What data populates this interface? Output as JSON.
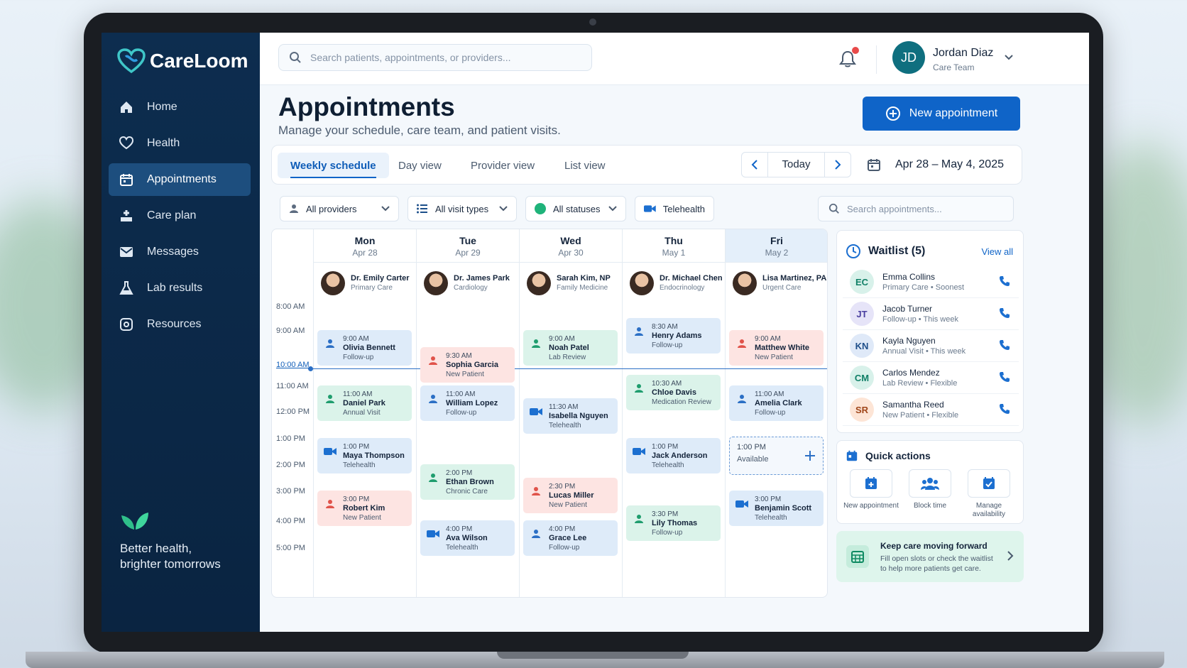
{
  "app": {
    "name": "CareLoom"
  },
  "sidebar": {
    "items": [
      {
        "label": "Home",
        "icon": "home-icon"
      },
      {
        "label": "Health",
        "icon": "heart-icon"
      },
      {
        "label": "Appointments",
        "icon": "calendar-icon"
      },
      {
        "label": "Care plan",
        "icon": "care-plan-icon"
      },
      {
        "label": "Messages",
        "icon": "mail-icon"
      },
      {
        "label": "Lab results",
        "icon": "flask-icon"
      },
      {
        "label": "Resources",
        "icon": "resources-icon"
      }
    ],
    "active": "Appointments",
    "tagline": "Better health, brighter tomorrows"
  },
  "topbar": {
    "search_placeholder": "Search patients, appointments, or providers...",
    "user": {
      "initials": "JD",
      "name": "Jordan Diaz",
      "role": "Care Team"
    }
  },
  "page": {
    "title": "Appointments",
    "subtitle": "Manage your schedule, care team, and patient visits.",
    "new_button": "New appointment"
  },
  "tabs": [
    "Weekly schedule",
    "Day view",
    "Provider view",
    "List view"
  ],
  "tabs_active": "Weekly schedule",
  "date_nav": {
    "today": "Today",
    "range": "Apr 28 – May 4, 2025"
  },
  "filters": {
    "providers": "All providers",
    "visit_types": "All visit types",
    "statuses": "All statuses",
    "telehealth": "Telehealth",
    "search_placeholder": "Search appointments..."
  },
  "calendar": {
    "days": [
      {
        "day": "Mon",
        "date": "Apr 28"
      },
      {
        "day": "Tue",
        "date": "Apr 29"
      },
      {
        "day": "Wed",
        "date": "Apr 30"
      },
      {
        "day": "Thu",
        "date": "May 1"
      },
      {
        "day": "Fri",
        "date": "May 2"
      }
    ],
    "providers": [
      {
        "name": "Dr. Emily Carter",
        "specialty": "Primary Care"
      },
      {
        "name": "Dr. James Park",
        "specialty": "Cardiology"
      },
      {
        "name": "Sarah Kim, NP",
        "specialty": "Family Medicine"
      },
      {
        "name": "Dr. Michael Chen",
        "specialty": "Endocrinology"
      },
      {
        "name": "Lisa Martinez, PA",
        "specialty": "Urgent Care"
      }
    ],
    "times": [
      "8:00 AM",
      "9:00 AM",
      "10:00 AM",
      "11:00 AM",
      "12:00 PM",
      "1:00 PM",
      "2:00 PM",
      "3:00 PM",
      "4:00 PM",
      "5:00 PM"
    ],
    "current_time": "10:00 AM",
    "appointments": [
      {
        "day": 0,
        "time": "9:00 AM",
        "patient": "Olivia Bennett",
        "type": "Follow-up",
        "color": "blue",
        "icon": "person-icon"
      },
      {
        "day": 0,
        "time": "11:00 AM",
        "patient": "Daniel Park",
        "type": "Annual Visit",
        "color": "green",
        "icon": "person-icon"
      },
      {
        "day": 0,
        "time": "1:00 PM",
        "patient": "Maya Thompson",
        "type": "Telehealth",
        "color": "blue",
        "icon": "video-icon"
      },
      {
        "day": 0,
        "time": "3:00 PM",
        "patient": "Robert Kim",
        "type": "New Patient",
        "color": "red",
        "icon": "person-icon"
      },
      {
        "day": 1,
        "time": "9:30 AM",
        "patient": "Sophia Garcia",
        "type": "New Patient",
        "color": "red",
        "icon": "person-icon"
      },
      {
        "day": 1,
        "time": "11:00 AM",
        "patient": "William Lopez",
        "type": "Follow-up",
        "color": "blue",
        "icon": "person-icon"
      },
      {
        "day": 1,
        "time": "2:00 PM",
        "patient": "Ethan Brown",
        "type": "Chronic Care",
        "color": "green",
        "icon": "person-icon"
      },
      {
        "day": 1,
        "time": "4:00 PM",
        "patient": "Ava Wilson",
        "type": "Telehealth",
        "color": "blue",
        "icon": "video-icon"
      },
      {
        "day": 2,
        "time": "9:00 AM",
        "patient": "Noah Patel",
        "type": "Lab Review",
        "color": "green",
        "icon": "person-icon"
      },
      {
        "day": 2,
        "time": "11:30 AM",
        "patient": "Isabella Nguyen",
        "type": "Telehealth",
        "color": "blue",
        "icon": "video-icon"
      },
      {
        "day": 2,
        "time": "2:30 PM",
        "patient": "Lucas Miller",
        "type": "New Patient",
        "color": "red",
        "icon": "person-icon"
      },
      {
        "day": 2,
        "time": "4:00 PM",
        "patient": "Grace Lee",
        "type": "Follow-up",
        "color": "blue",
        "icon": "person-icon"
      },
      {
        "day": 3,
        "time": "8:30 AM",
        "patient": "Henry Adams",
        "type": "Follow-up",
        "color": "blue",
        "icon": "person-icon"
      },
      {
        "day": 3,
        "time": "10:30 AM",
        "patient": "Chloe Davis",
        "type": "Medication Review",
        "color": "green",
        "icon": "person-icon"
      },
      {
        "day": 3,
        "time": "1:00 PM",
        "patient": "Jack Anderson",
        "type": "Telehealth",
        "color": "blue",
        "icon": "video-icon"
      },
      {
        "day": 3,
        "time": "3:30 PM",
        "patient": "Lily Thomas",
        "type": "Follow-up",
        "color": "green",
        "icon": "person-icon"
      },
      {
        "day": 4,
        "time": "9:00 AM",
        "patient": "Matthew White",
        "type": "New Patient",
        "color": "red",
        "icon": "person-icon"
      },
      {
        "day": 4,
        "time": "11:00 AM",
        "patient": "Amelia Clark",
        "type": "Follow-up",
        "color": "blue",
        "icon": "person-icon"
      },
      {
        "day": 4,
        "time": "3:00 PM",
        "patient": "Benjamin Scott",
        "type": "Telehealth",
        "color": "blue",
        "icon": "video-icon"
      }
    ],
    "available_slot": {
      "time": "1:00 PM",
      "label": "Available"
    }
  },
  "waitlist": {
    "title": "Waitlist (5)",
    "view_all": "View all",
    "items": [
      {
        "initials": "EC",
        "name": "Emma Collins",
        "detail": "Primary Care • Soonest",
        "color": "#d8f1ea",
        "fg": "#0f7f66"
      },
      {
        "initials": "JT",
        "name": "Jacob Turner",
        "detail": "Follow-up • This week",
        "color": "#e6e4f8",
        "fg": "#4a3fa0"
      },
      {
        "initials": "KN",
        "name": "Kayla Nguyen",
        "detail": "Annual Visit • This week",
        "color": "#dfe9f8",
        "fg": "#1f4f8a"
      },
      {
        "initials": "CM",
        "name": "Carlos Mendez",
        "detail": "Lab Review • Flexible",
        "color": "#d8f1ea",
        "fg": "#0f7f66"
      },
      {
        "initials": "SR",
        "name": "Samantha Reed",
        "detail": "New Patient • Flexible",
        "color": "#fde5d6",
        "fg": "#a0461a"
      }
    ]
  },
  "quick_actions": {
    "title": "Quick actions",
    "items": [
      {
        "label": "New appointment",
        "icon": "calendar-add-icon"
      },
      {
        "label": "Block time",
        "icon": "people-icon"
      },
      {
        "label": "Manage availability",
        "icon": "calendar-check-icon"
      }
    ]
  },
  "promo": {
    "title": "Keep care moving forward",
    "text": "Fill open slots or check the waitlist to help more patients get care."
  },
  "colors": {
    "accent": "#0f64c8",
    "sidebar": "#0d2d4f",
    "green": "#dbf3ea",
    "blue": "#deebf9",
    "red": "#fde4e2"
  }
}
